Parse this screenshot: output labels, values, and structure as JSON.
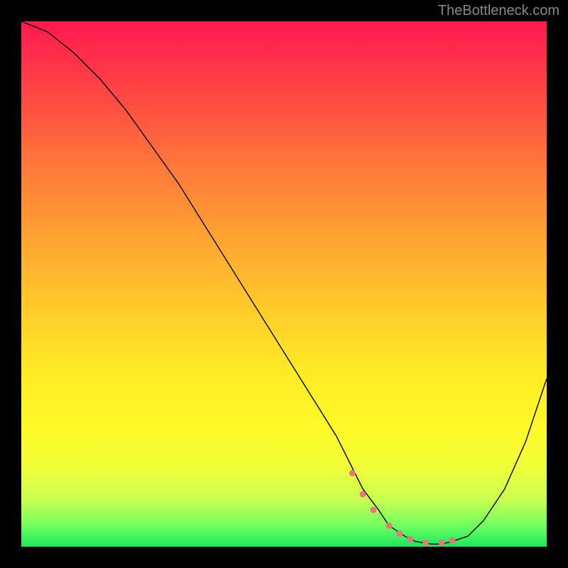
{
  "watermark": "TheBottleneck.com",
  "chart_data": {
    "type": "line",
    "title": "",
    "xlabel": "",
    "ylabel": "",
    "xlim": [
      0,
      100
    ],
    "ylim": [
      0,
      100
    ],
    "series": [
      {
        "name": "bottleneck-curve",
        "x": [
          0,
          5,
          10,
          15,
          20,
          25,
          30,
          35,
          40,
          45,
          50,
          55,
          60,
          63,
          65,
          68,
          70,
          73,
          75,
          78,
          80,
          82,
          85,
          88,
          92,
          96,
          100
        ],
        "y": [
          100,
          98,
          94,
          89,
          83,
          76,
          69,
          61,
          53,
          45,
          37,
          29,
          21,
          15,
          11,
          7,
          4,
          2,
          1,
          0.5,
          0.5,
          1,
          2,
          5,
          11,
          20,
          32
        ]
      }
    ],
    "markers": {
      "name": "highlight-range",
      "color": "#e87878",
      "x": [
        63,
        65,
        67,
        70,
        72,
        74,
        77,
        80,
        82
      ],
      "y": [
        14,
        10,
        7,
        4,
        2.5,
        1.5,
        0.8,
        0.8,
        1.2
      ]
    },
    "background_gradient": {
      "top": "#ff1a4d",
      "middle": "#ffed24",
      "bottom": "#18e860"
    }
  }
}
